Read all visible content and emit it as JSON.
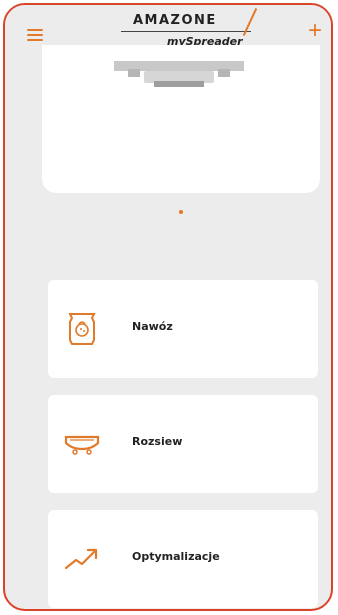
{
  "header": {
    "brand_name": "AMAZONE",
    "brand_sub": "mySpreader",
    "add_label": "+"
  },
  "menu": {
    "items": [
      {
        "label": "Nawóz",
        "icon": "fertilizer-bag-icon"
      },
      {
        "label": "Rozsiew",
        "icon": "spreader-icon"
      },
      {
        "label": "Optymalizacje",
        "icon": "trend-up-icon"
      }
    ]
  },
  "colors": {
    "accent": "#e27a2b",
    "frame": "#d9442a",
    "background": "#ececec",
    "card": "#ffffff"
  }
}
